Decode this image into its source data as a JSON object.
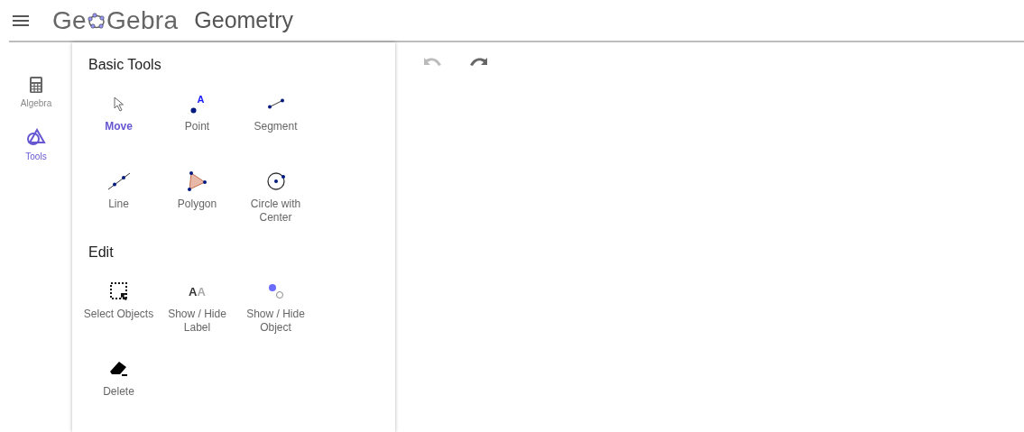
{
  "header": {
    "logo": {
      "before": "Ge",
      "after": "Gebra"
    },
    "app_title": "Geometry"
  },
  "sidebar": {
    "items": [
      {
        "kind": "calculator",
        "label": "Algebra",
        "selected": false
      },
      {
        "kind": "shapes",
        "label": "Tools",
        "selected": true
      }
    ]
  },
  "tool_groups": [
    {
      "title": "Basic Tools",
      "tools": [
        {
          "kind": "move",
          "label": "Move",
          "selected": true
        },
        {
          "kind": "point",
          "label": "Point",
          "icon_text": "A",
          "selected": false
        },
        {
          "kind": "segment",
          "label": "Segment",
          "selected": false
        },
        {
          "kind": "line",
          "label": "Line",
          "selected": false
        },
        {
          "kind": "polygon",
          "label": "Polygon",
          "selected": false
        },
        {
          "kind": "circle",
          "label": "Circle with Center",
          "selected": false
        }
      ]
    },
    {
      "title": "Edit",
      "tools": [
        {
          "kind": "select",
          "label": "Select Objects",
          "selected": false
        },
        {
          "kind": "label",
          "label": "Show / Hide Label",
          "icon_glyphs": [
            "A",
            "A"
          ],
          "selected": false
        },
        {
          "kind": "visibility",
          "label": "Show / Hide Object",
          "selected": false
        },
        {
          "kind": "delete",
          "label": "Delete",
          "selected": false
        }
      ]
    }
  ],
  "canvas": {
    "undo": {
      "disabled": true
    },
    "redo": {
      "disabled": false
    }
  }
}
